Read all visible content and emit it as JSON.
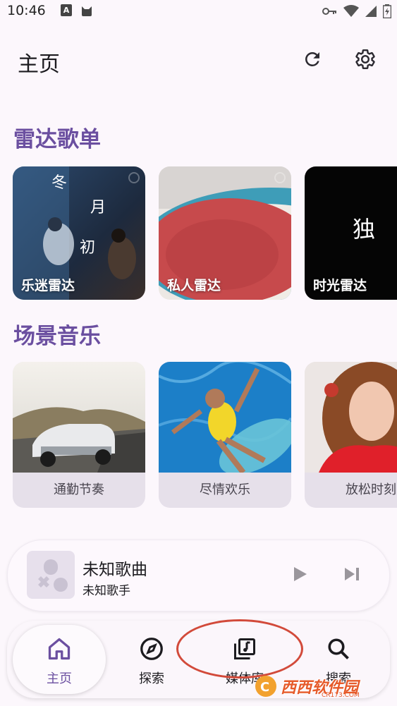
{
  "status_bar": {
    "time": "10:46"
  },
  "header": {
    "title": "主页"
  },
  "radar": {
    "section_title": "雷达歌单",
    "cards": [
      {
        "label": "乐迷雷达"
      },
      {
        "label": "私人雷达"
      },
      {
        "label": "时光雷达"
      }
    ]
  },
  "scene": {
    "section_title": "场景音乐",
    "cards": [
      {
        "label": "通勤节奏"
      },
      {
        "label": "尽情欢乐"
      },
      {
        "label": "放松时刻"
      }
    ]
  },
  "player": {
    "title": "未知歌曲",
    "artist": "未知歌手"
  },
  "nav": {
    "items": [
      {
        "label": "主页",
        "icon": "home-icon",
        "active": true
      },
      {
        "label": "探索",
        "icon": "compass-icon",
        "active": false
      },
      {
        "label": "媒体库",
        "icon": "library-icon",
        "active": false
      },
      {
        "label": "搜索",
        "icon": "search-icon",
        "active": false
      }
    ]
  },
  "watermark": {
    "text": "西西软件园",
    "sub": "CR173.COM"
  },
  "colors": {
    "accent": "#6b4fa0",
    "background": "#fcf7fc",
    "annotation": "#d24a3a"
  }
}
